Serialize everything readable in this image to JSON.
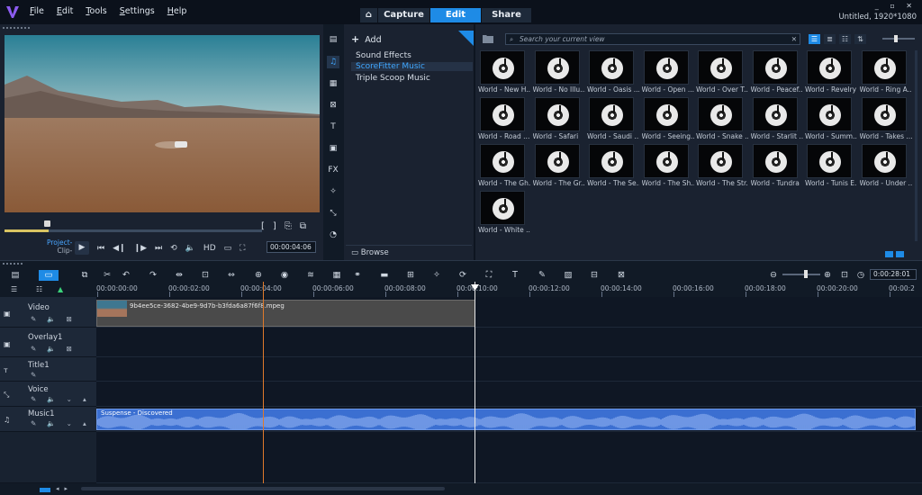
{
  "app": {
    "menu": [
      "File",
      "Edit",
      "Tools",
      "Settings",
      "Help"
    ],
    "mode_tabs": [
      "Capture",
      "Edit",
      "Share"
    ],
    "active_mode": "Edit",
    "project_info": "Untitled, 1920*1080",
    "window_controls": "_ ▫ ✕"
  },
  "player": {
    "project_label": "Project-",
    "clip_label": "Clip-",
    "scrub_position": 0.17,
    "quality_label": "HD",
    "timecode": "00:00:04:06",
    "bracket_in": "[",
    "bracket_out": "]"
  },
  "library": {
    "add_label": "Add",
    "nav_items": [
      "Sound Effects",
      "ScoreFitter Music",
      "Triple Scoop Music"
    ],
    "selected_nav": "ScoreFitter Music",
    "browse_label": "Browse",
    "search_placeholder": "Search your current view",
    "tiles": [
      "World - New H...",
      "World - No Illu...",
      "World - Oasis ...",
      "World - Open ...",
      "World - Over T...",
      "World - Peacef...",
      "World - Revelry",
      "World - Ring A...",
      "World - Road ...",
      "World - Safari",
      "World - Saudi ...",
      "World - Seeing...",
      "World - Snake ...",
      "World - Starlit ...",
      "World - Summ...",
      "World - Takes ...",
      "World - The Gh...",
      "World - The Gr...",
      "World - The Se...",
      "World - The Sh...",
      "World - The Str...",
      "World - Tundra",
      "World - Tunis E...",
      "World - Under ...",
      "World - White ..."
    ]
  },
  "timeline": {
    "duration": "0:00:28:01",
    "ruler_labels": [
      "00:00:00:00",
      "00:00:02:00",
      "00:00:04:00",
      "00:00:06:00",
      "00:00:08:00",
      "00:00:10:00",
      "00:00:12:00",
      "00:00:14:00",
      "00:00:16:00",
      "00:00:18:00",
      "00:00:20:00",
      "00:00:2"
    ],
    "tracks": [
      {
        "name": "Video"
      },
      {
        "name": "Overlay1"
      },
      {
        "name": "Title1"
      },
      {
        "name": "Voice"
      },
      {
        "name": "Music1"
      }
    ],
    "video_clip_name": "9b4ee5ce-3682-4be9-9d7b-b3fda6a87f6f8.mpeg",
    "music_clip_name": "Suspense - Discovered"
  },
  "colors": {
    "accent": "#1e8be6",
    "music_clip": "#3b6fd1",
    "playhead_marker": "#e07a2b"
  }
}
